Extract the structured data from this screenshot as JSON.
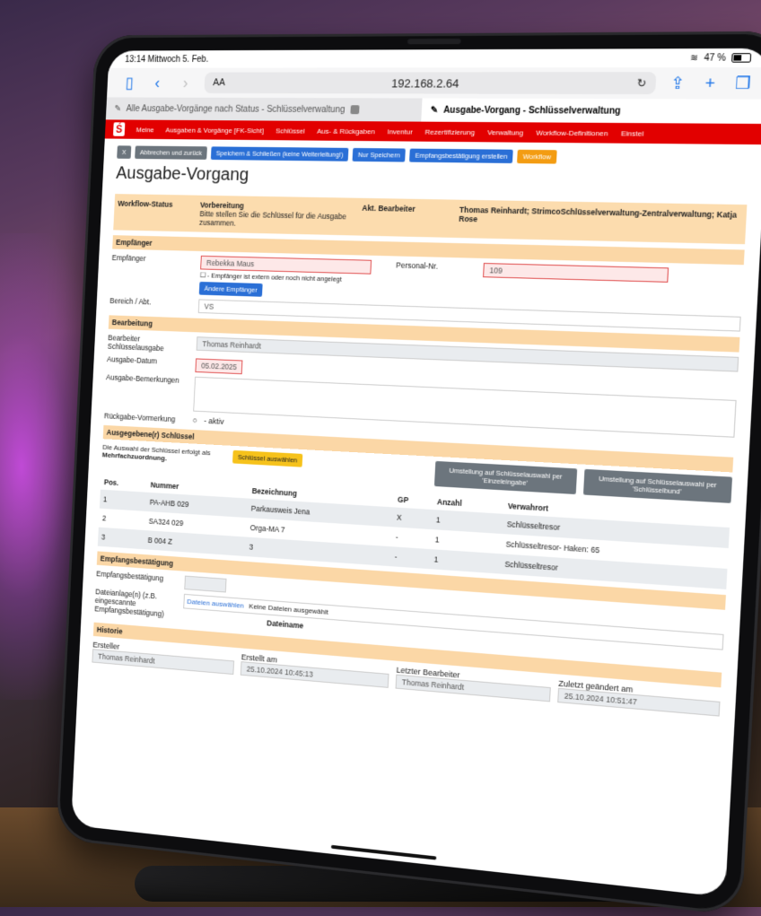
{
  "statusbar": {
    "time": "13:14",
    "date": "Mittwoch 5. Feb.",
    "battery": "47 %"
  },
  "browser": {
    "aa_label": "AA",
    "url": "192.168.2.64",
    "tabs": [
      {
        "label": "Alle Ausgabe-Vorgänge nach Status - Schlüsselverwaltung"
      },
      {
        "label": "Ausgabe-Vorgang - Schlüsselverwaltung"
      }
    ]
  },
  "nav": {
    "items": [
      "Meine",
      "Ausgaben & Vorgänge [FK-Sicht]",
      "Schlüssel",
      "Aus- & Rückgaben",
      "Inventur",
      "Rezertifizierung",
      "Verwaltung",
      "Workflow-Definitionen",
      "Einstel"
    ]
  },
  "actions": {
    "x": "X",
    "cancel": "Abbrechen und zurück",
    "save_close": "Speichern & Schließen (keine Weiterleitung!)",
    "save_only": "Nur Speichern",
    "receipt": "Empfangsbestätigung erstellen",
    "workflow": "Workflow"
  },
  "page": {
    "title": "Ausgabe-Vorgang"
  },
  "workflow": {
    "label": "Workflow-Status",
    "state": "Vorbereitung",
    "state_text": "Bitte stellen Sie die Schlüssel für die Ausgabe zusammen.",
    "editor_label": "Akt. Bearbeiter",
    "editor_value": "Thomas Reinhardt; StrimcoSchlüsselverwaltung-Zentralverwaltung; Katja Rose"
  },
  "recipient": {
    "section": "Empfänger",
    "label": "Empfänger",
    "value": "Rebekka Maus",
    "external_note": "- Empfänger ist extern oder noch nicht angelegt",
    "change_btn": "Ändere Empfänger",
    "personal_label": "Personal-Nr.",
    "personal_value": "109",
    "dept_label": "Bereich / Abt.",
    "dept_value": "VS"
  },
  "processing": {
    "section": "Bearbeitung",
    "editor_label": "Bearbeiter Schlüsselausgabe",
    "editor_value": "Thomas Reinhardt",
    "date_label": "Ausgabe-Datum",
    "date_value": "05.02.2025",
    "remarks_label": "Ausgabe-Bemerkungen",
    "return_label": "Rückgabe-Vormerkung",
    "return_value": "- aktiv"
  },
  "keys": {
    "section": "Ausgegebene(r) Schlüssel",
    "note_1": "Die Auswahl der Schlüssel erfolgt als",
    "note_2": "Mehrfachzuordnung.",
    "select_btn": "Schlüssel auswählen",
    "switch_single": "Umstellung auf Schlüsselauswahl per 'Einzeleingabe'",
    "switch_bundle": "Umstellung auf Schlüsselauswahl per 'Schlüsselbund'",
    "columns": [
      "Pos.",
      "Nummer",
      "Bezeichnung",
      "GP",
      "Anzahl",
      "Verwahrort"
    ],
    "rows": [
      [
        "1",
        "PA-AHB 029",
        "Parkausweis Jena",
        "X",
        "1",
        "Schlüsseltresor"
      ],
      [
        "2",
        "SA324 029",
        "Orga-MA 7",
        "-",
        "1",
        "Schlüsseltresor- Haken: 65"
      ],
      [
        "3",
        "B 004 Z",
        "3",
        "-",
        "1",
        "Schlüsseltresor"
      ]
    ]
  },
  "receipt": {
    "section": "Empfangsbestätigung",
    "label": "Empfangsbestätigung",
    "file_label": "Dateianlage(n) (z.B. eingescannte Empfangsbestätigung)",
    "file_btn": "Dateien auswählen",
    "file_status": "Keine Dateien ausgewählt",
    "file_col": "Dateiname"
  },
  "history": {
    "section": "Historie",
    "creator_label": "Ersteller",
    "creator_value": "Thomas Reinhardt",
    "created_label": "Erstellt am",
    "created_value": "25.10.2024 10:45:13",
    "last_editor_label": "Letzter Bearbeiter",
    "last_editor_value": "Thomas Reinhardt",
    "changed_label": "Zuletzt geändert am",
    "changed_value": "25.10.2024 10:51:47"
  }
}
